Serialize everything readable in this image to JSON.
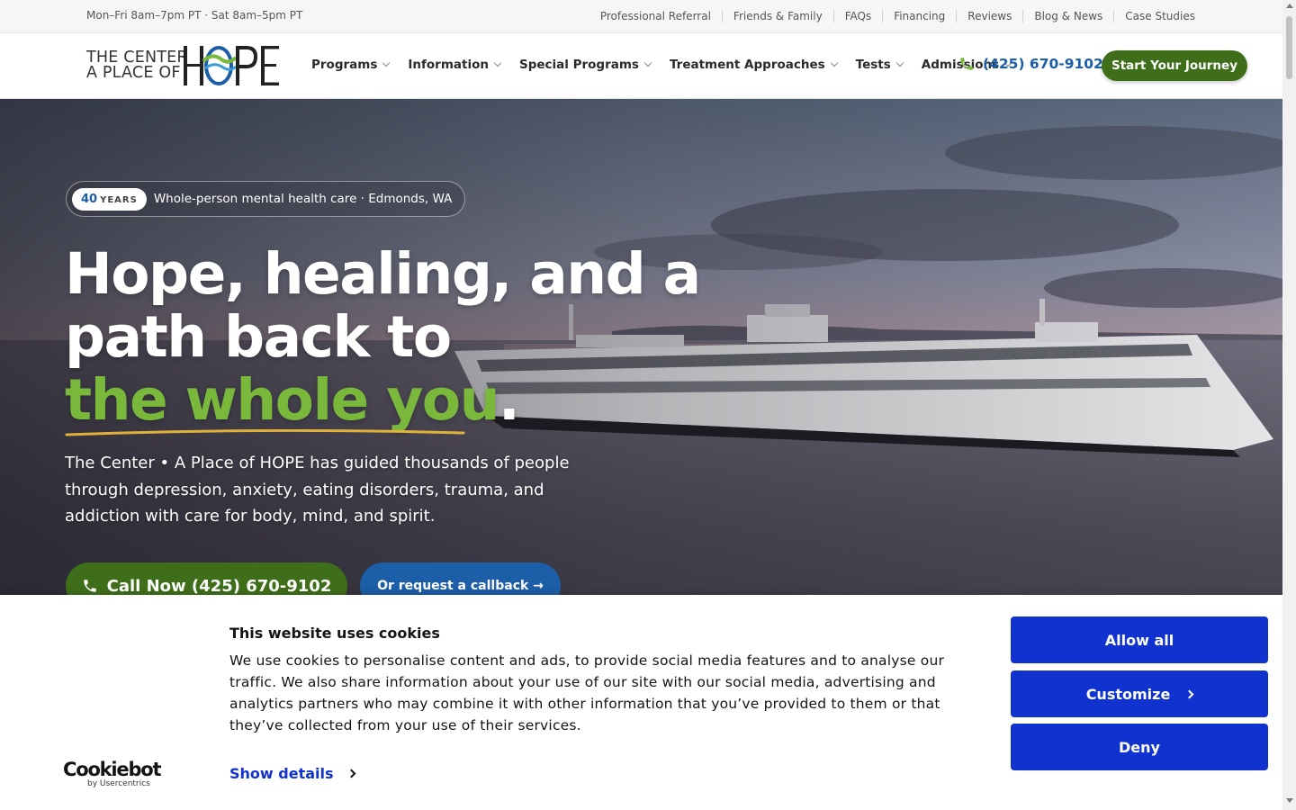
{
  "topbar": {
    "hours": "Mon–Fri 8am–7pm PT · Sat 8am–5pm PT",
    "links": [
      "Professional Referral",
      "Friends & Family",
      "FAQs",
      "Financing",
      "Reviews",
      "Blog & News",
      "Case Studies"
    ]
  },
  "logo": {
    "line1": "THE CENTER",
    "line2": "A PLACE OF",
    "word": "HOPE"
  },
  "nav": {
    "items": [
      "Programs",
      "Information",
      "Special Programs",
      "Treatment Approaches",
      "Tests",
      "Admissions"
    ],
    "phone": "(425) 670-9102",
    "cta": "Start Your Journey"
  },
  "hero": {
    "badge_number": "40",
    "badge_unit": "YEARS",
    "badge_text": "Whole-person mental health care · Edmonds, WA",
    "headline_line1": "Hope, healing, and a",
    "headline_line2": "path back to",
    "headline_highlight": "the whole you",
    "headline_period": ".",
    "lede": "The Center • A Place of HOPE has guided thousands of people through depression, anxiety, eating disorders, trauma, and addiction with care for body, mind, and spirit.",
    "call_button": "Call Now (425) 670-9102",
    "callback_button": "Or request a callback →"
  },
  "cookie": {
    "brand_name": "Cookiebot",
    "brand_sub": "by Usercentrics",
    "title": "This website uses cookies",
    "body": "We use cookies to personalise content and ads, to provide social media features and to analyse our traffic. We also share information about your use of our site with our social media, advertising and analytics partners who may combine it with other information that you’ve provided to them or that they’ve collected from your use of their services.",
    "show_details": "Show details",
    "allow_all": "Allow all",
    "customize": "Customize",
    "deny": "Deny"
  },
  "colors": {
    "brand_green": "#3f6e1a",
    "brand_blue": "#1d5ea8",
    "highlight_green": "#7ab83c",
    "cookie_blue": "#1032cf"
  }
}
